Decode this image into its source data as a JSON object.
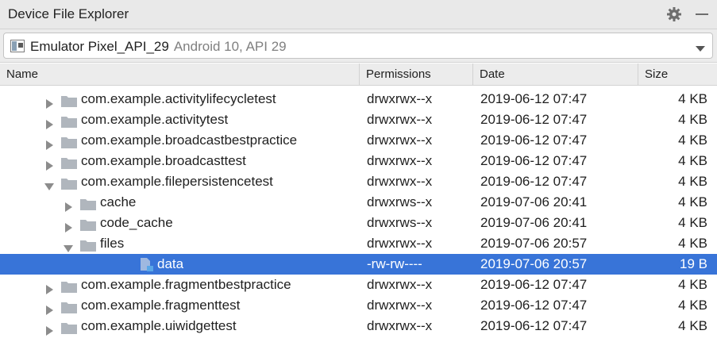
{
  "panel": {
    "title": "Device File Explorer",
    "settings_icon": "gear-icon",
    "minimize_icon": "minimize-icon"
  },
  "device": {
    "name": "Emulator Pixel_API_29",
    "info": "Android 10, API 29",
    "icon": "device-icon"
  },
  "columns": {
    "name": "Name",
    "permissions": "Permissions",
    "date": "Date",
    "size": "Size"
  },
  "colors": {
    "selection": "#3874d8",
    "folder": "#b0b6bd",
    "triangle": "#8c8c8c"
  },
  "rows": [
    {
      "name": "com.example.activitylifecycletest",
      "permissions": "drwxrwx--x",
      "date": "2019-06-12 07:47",
      "size": "4 KB",
      "depth": 0,
      "expanded": false,
      "kind": "folder"
    },
    {
      "name": "com.example.activitytest",
      "permissions": "drwxrwx--x",
      "date": "2019-06-12 07:47",
      "size": "4 KB",
      "depth": 0,
      "expanded": false,
      "kind": "folder"
    },
    {
      "name": "com.example.broadcastbestpractice",
      "permissions": "drwxrwx--x",
      "date": "2019-06-12 07:47",
      "size": "4 KB",
      "depth": 0,
      "expanded": false,
      "kind": "folder"
    },
    {
      "name": "com.example.broadcasttest",
      "permissions": "drwxrwx--x",
      "date": "2019-06-12 07:47",
      "size": "4 KB",
      "depth": 0,
      "expanded": false,
      "kind": "folder"
    },
    {
      "name": "com.example.filepersistencetest",
      "permissions": "drwxrwx--x",
      "date": "2019-06-12 07:47",
      "size": "4 KB",
      "depth": 0,
      "expanded": true,
      "kind": "folder"
    },
    {
      "name": "cache",
      "permissions": "drwxrws--x",
      "date": "2019-07-06 20:41",
      "size": "4 KB",
      "depth": 1,
      "expanded": false,
      "kind": "folder"
    },
    {
      "name": "code_cache",
      "permissions": "drwxrws--x",
      "date": "2019-07-06 20:41",
      "size": "4 KB",
      "depth": 1,
      "expanded": false,
      "kind": "folder"
    },
    {
      "name": "files",
      "permissions": "drwxrwx--x",
      "date": "2019-07-06 20:57",
      "size": "4 KB",
      "depth": 1,
      "expanded": true,
      "kind": "folder"
    },
    {
      "name": "data",
      "permissions": "-rw-rw----",
      "date": "2019-07-06 20:57",
      "size": "19 B",
      "depth": 2,
      "expanded": false,
      "kind": "file",
      "selected": true
    },
    {
      "name": "com.example.fragmentbestpractice",
      "permissions": "drwxrwx--x",
      "date": "2019-06-12 07:47",
      "size": "4 KB",
      "depth": 0,
      "expanded": false,
      "kind": "folder"
    },
    {
      "name": "com.example.fragmenttest",
      "permissions": "drwxrwx--x",
      "date": "2019-06-12 07:47",
      "size": "4 KB",
      "depth": 0,
      "expanded": false,
      "kind": "folder"
    },
    {
      "name": "com.example.uiwidgettest",
      "permissions": "drwxrwx--x",
      "date": "2019-06-12 07:47",
      "size": "4 KB",
      "depth": 0,
      "expanded": false,
      "kind": "folder"
    }
  ]
}
